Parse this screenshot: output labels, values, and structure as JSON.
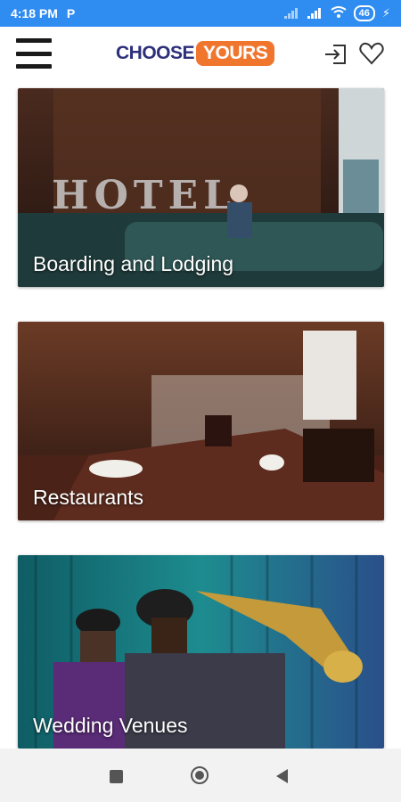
{
  "status_bar": {
    "time": "4:18 PM",
    "notification_icon": "parking-p-icon",
    "battery": "46"
  },
  "header": {
    "logo_part1": "CHOOSE",
    "logo_part2": "YOURS",
    "menu_icon": "hamburger-menu-icon",
    "login_icon": "login-icon",
    "favorites_icon": "heart-icon",
    "colors": {
      "brand_blue": "#2d2f7a",
      "brand_orange": "#f0762e",
      "status_bar": "#2f8cf0"
    }
  },
  "categories": [
    {
      "label": "Boarding and Lodging"
    },
    {
      "label": "Restaurants"
    },
    {
      "label": "Wedding Venues"
    }
  ],
  "nav": {
    "recents_icon": "square-recents-icon",
    "home_icon": "circle-home-icon",
    "back_icon": "triangle-back-icon"
  }
}
